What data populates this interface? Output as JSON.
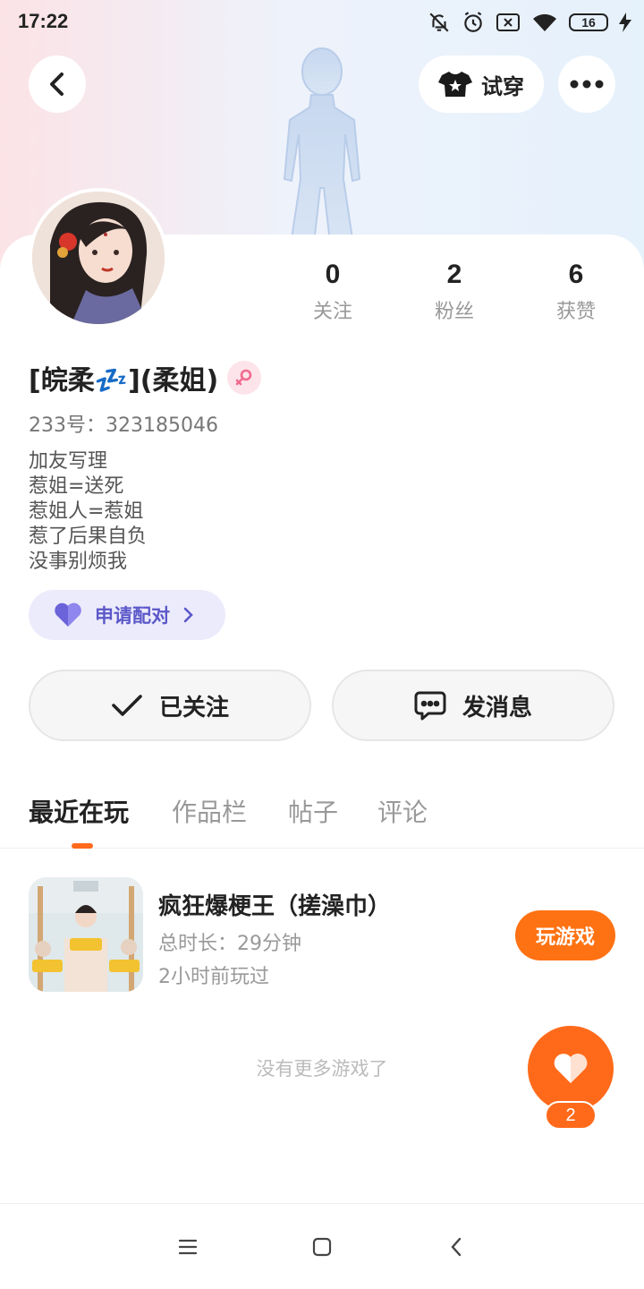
{
  "status_bar": {
    "time": "17:22",
    "battery": "16",
    "icons": [
      "bell-muted-icon",
      "alarm-icon",
      "sim-off-icon",
      "wifi-icon",
      "battery-icon",
      "charging-icon"
    ]
  },
  "header": {
    "try_on_label": "试穿"
  },
  "profile": {
    "stats": [
      {
        "value": "0",
        "label": "关注"
      },
      {
        "value": "2",
        "label": "粉丝"
      },
      {
        "value": "6",
        "label": "获赞"
      }
    ],
    "username": "[皖柔💤](柔姐)",
    "uid": "233号：323185046",
    "bio_lines": [
      "加友写理",
      "惹姐=送死",
      "惹姐人=惹姐",
      "惹了后果自负",
      "没事别烦我"
    ],
    "match_label": "申请配对"
  },
  "actions": {
    "following_label": "已关注",
    "message_label": "发消息"
  },
  "tabs": [
    "最近在玩",
    "作品栏",
    "帖子",
    "评论"
  ],
  "games": [
    {
      "title": "疯狂爆梗王（搓澡巾）",
      "duration": "总时长：29分钟",
      "last_played": "2小时前玩过",
      "play_label": "玩游戏"
    }
  ],
  "no_more_text": "没有更多游戏了",
  "like": {
    "count": "2"
  },
  "colors": {
    "accent": "#ff6a1a",
    "match_purple": "#5b58c9"
  }
}
